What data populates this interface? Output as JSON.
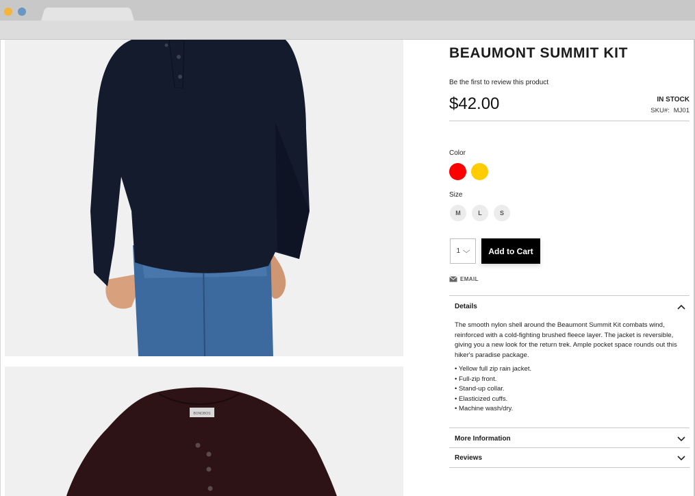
{
  "browser": {
    "window_controls": [
      "close-dot",
      "minimize-dot"
    ],
    "tab_label": ""
  },
  "gallery": {
    "images": [
      {
        "name": "navy-henley-model-photo",
        "color": "#111a2e"
      },
      {
        "name": "burgundy-henley-flat-photo",
        "color": "#2b1214"
      }
    ],
    "tag_text": "BONOBOS"
  },
  "product": {
    "title": "BEAUMONT SUMMIT KIT",
    "review_link": "Be the first to review this product",
    "price": "$42.00",
    "stock": "IN STOCK",
    "sku_label": "SKU#:",
    "sku_value": "MJ01"
  },
  "options": {
    "color_label": "Color",
    "colors": [
      {
        "name": "red",
        "hex": "#ff0000"
      },
      {
        "name": "yellow",
        "hex": "#ffcc00"
      }
    ],
    "size_label": "Size",
    "sizes": [
      "M",
      "L",
      "S"
    ]
  },
  "cart": {
    "quantity": "1",
    "add_label": "Add to Cart",
    "email_label": "EMAIL"
  },
  "accordion": {
    "details_title": "Details",
    "details_text": "The smooth nylon shell around the Beaumont Summit Kit combats wind, reinforced with a cold-fighting brushed fleece layer. The jacket is reversible, giving you a new look for the return trek. Ample pocket space rounds out this hiker's paradise package.",
    "features": [
      "Yellow full zip rain jacket.",
      "Full-zip front.",
      "Stand-up collar.",
      "Elasticized cuffs.",
      "Machine wash/dry."
    ],
    "more_info_title": "More Information",
    "reviews_title": "Reviews"
  }
}
